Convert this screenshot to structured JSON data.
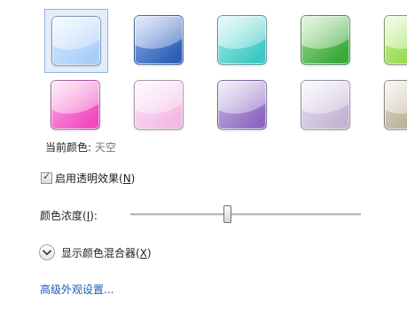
{
  "swatches": [
    {
      "name": "sky",
      "top": "#a9cdfa",
      "bottom": "#d9ebff",
      "selected": true
    },
    {
      "name": "twilight",
      "top": "#2c5fb8",
      "bottom": "#8fb0e8",
      "selected": false
    },
    {
      "name": "sea",
      "top": "#3cc8c4",
      "bottom": "#a8ece8",
      "selected": false
    },
    {
      "name": "leaf",
      "top": "#3aa83a",
      "bottom": "#9ddd8e",
      "selected": false
    },
    {
      "name": "lime",
      "top": "#86d43c",
      "bottom": "#d1f2a4",
      "selected": false
    },
    {
      "name": "lemon",
      "top": "#efe56a",
      "bottom": "#fbf6c0",
      "selected": false
    },
    {
      "name": "fuchsia",
      "top": "#f048c0",
      "bottom": "#fbb4e4",
      "selected": false
    },
    {
      "name": "blush",
      "top": "#f2b9e6",
      "bottom": "#fde6f7",
      "selected": false
    },
    {
      "name": "violet",
      "top": "#8c68c0",
      "bottom": "#cdbde6",
      "selected": false
    },
    {
      "name": "lavender",
      "top": "#c3b4d3",
      "bottom": "#ebe4f1",
      "selected": false
    },
    {
      "name": "taupe",
      "top": "#b3a68a",
      "bottom": "#e3dccb",
      "selected": false
    },
    {
      "name": "chocolate",
      "top": "#6e4a40",
      "bottom": "#bea49a",
      "selected": false
    }
  ],
  "current_color": {
    "label": "当前颜色:",
    "value": "天空"
  },
  "transparency": {
    "label_prefix": "启用透明效果(",
    "accel_key": "N",
    "label_suffix": ")",
    "checked": true,
    "check_glyph": "✓"
  },
  "intensity": {
    "label_prefix": "颜色浓度(",
    "accel_key": "I",
    "label_suffix": "):",
    "value_fraction": 0.42
  },
  "mixer": {
    "label_prefix": "显示颜色混合器(",
    "accel_key": "X",
    "label_suffix": ")",
    "icon": "chevron-down-icon"
  },
  "advanced_link": "高级外观设置..."
}
